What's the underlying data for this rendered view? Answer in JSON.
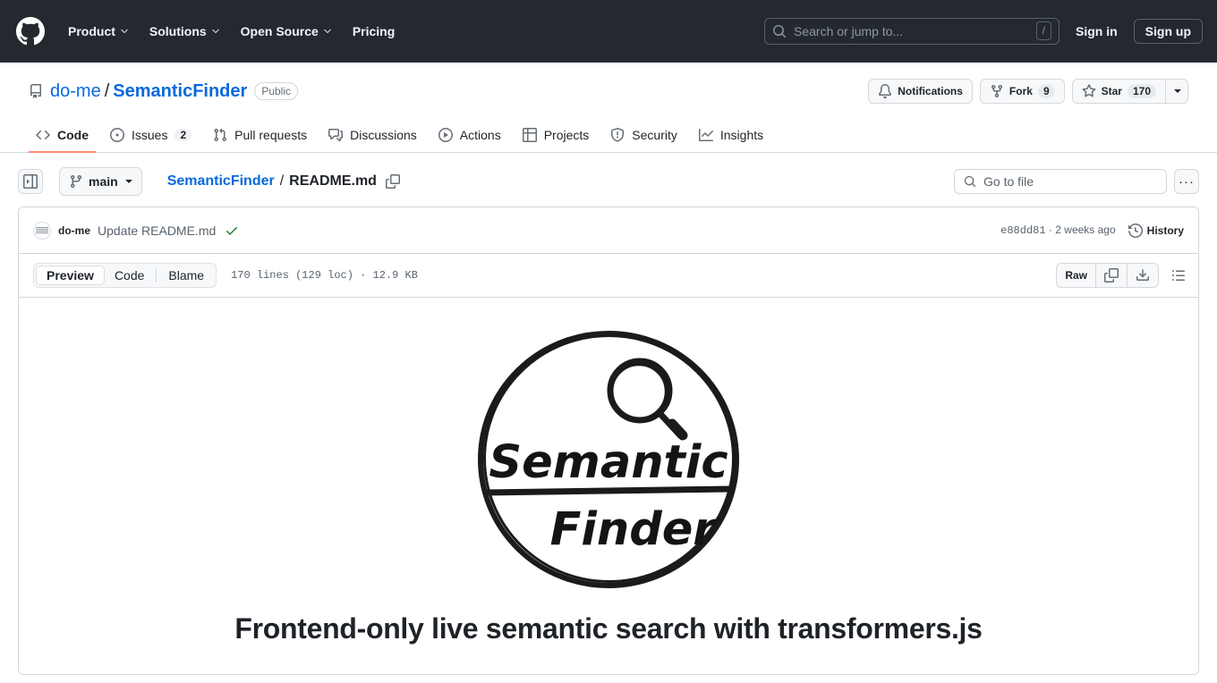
{
  "global_nav": {
    "logo_icon": "github-mark-icon",
    "items": [
      {
        "label": "Product",
        "has_chevron": true
      },
      {
        "label": "Solutions",
        "has_chevron": true
      },
      {
        "label": "Open Source",
        "has_chevron": true
      },
      {
        "label": "Pricing",
        "has_chevron": false
      }
    ],
    "search": {
      "placeholder": "Search or jump to...",
      "shortcut": "/",
      "icon": "search-icon"
    },
    "sign_in": "Sign in",
    "sign_up": "Sign up"
  },
  "repo": {
    "icon": "repo-icon",
    "owner": "do-me",
    "separator": "/",
    "name": "SemanticFinder",
    "visibility": "Public",
    "actions": {
      "notifications": {
        "label": "Notifications",
        "icon": "bell-icon"
      },
      "fork": {
        "label": "Fork",
        "count": "9",
        "icon": "fork-icon"
      },
      "star": {
        "label": "Star",
        "count": "170",
        "icon": "star-icon"
      },
      "star_dropdown_icon": "triangle-down-icon"
    },
    "tabs": [
      {
        "label": "Code",
        "icon": "code-icon",
        "active": true,
        "count": null
      },
      {
        "label": "Issues",
        "icon": "issue-opened-icon",
        "active": false,
        "count": "2"
      },
      {
        "label": "Pull requests",
        "icon": "git-pull-request-icon",
        "active": false,
        "count": null
      },
      {
        "label": "Discussions",
        "icon": "comment-discussion-icon",
        "active": false,
        "count": null
      },
      {
        "label": "Actions",
        "icon": "play-icon",
        "active": false,
        "count": null
      },
      {
        "label": "Projects",
        "icon": "table-icon",
        "active": false,
        "count": null
      },
      {
        "label": "Security",
        "icon": "shield-icon",
        "active": false,
        "count": null
      },
      {
        "label": "Insights",
        "icon": "graph-icon",
        "active": false,
        "count": null
      }
    ]
  },
  "file_nav": {
    "sidebar_toggle_icon": "sidebar-expand-icon",
    "branch": {
      "name": "main",
      "icon": "git-branch-icon"
    },
    "breadcrumb": {
      "root": "SemanticFinder",
      "separator": "/",
      "current": "README.md",
      "copy_path_icon": "copy-icon"
    },
    "go_to_file": {
      "placeholder": "Go to file",
      "icon": "search-icon"
    },
    "more_options": "···"
  },
  "commit": {
    "avatar": "user-avatar",
    "author": "do-me",
    "message": "Update README.md",
    "status_icon": "check-icon",
    "sha": "e88dd81",
    "sha_separator": "·",
    "relative_time": "2 weeks ago",
    "history_label": "History",
    "history_icon": "history-icon"
  },
  "file_toolbar": {
    "views": [
      {
        "label": "Preview",
        "active": true
      },
      {
        "label": "Code",
        "active": false
      },
      {
        "label": "Blame",
        "active": false
      }
    ],
    "file_meta": "170 lines (129 loc) · 12.9 KB",
    "raw_label": "Raw",
    "copy_icon": "copy-icon",
    "download_icon": "download-icon",
    "outline_icon": "list-unordered-icon"
  },
  "readme": {
    "logo_alt": "semanticfinder-logo",
    "logo_text_top": "Semantic",
    "logo_text_bottom": "Finder",
    "heading": "Frontend-only live semantic search with transformers.js"
  },
  "colors": {
    "header_bg": "#24292f",
    "accent_link": "#0969da",
    "active_tab_underline": "#fd8c73",
    "success_green": "#1a7f37",
    "border": "#d0d7de"
  }
}
